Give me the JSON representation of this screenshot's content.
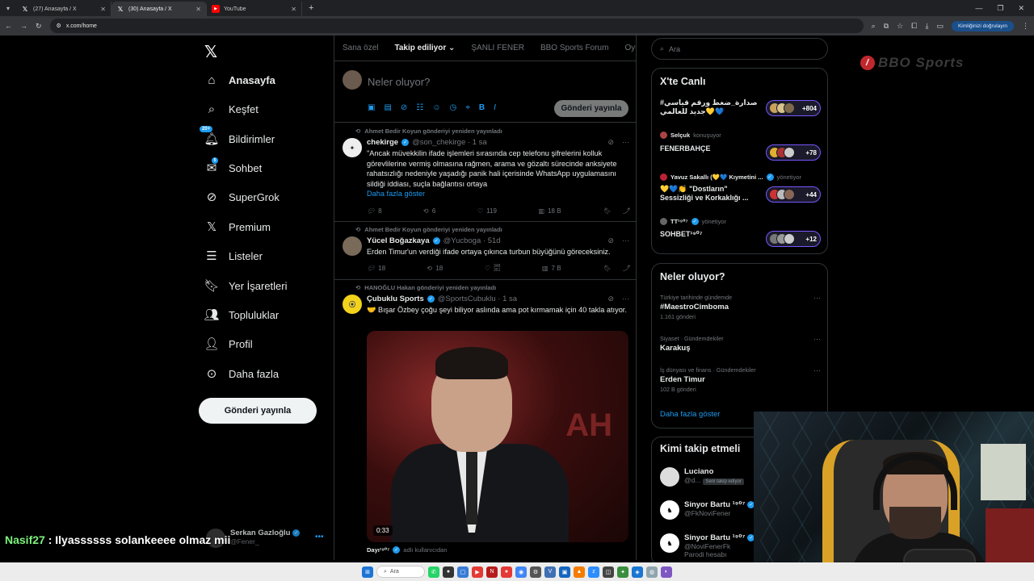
{
  "browser": {
    "tabs": [
      {
        "title": "(27) Anasayfa / X",
        "icon": "x-icon"
      },
      {
        "title": "(30) Anasayfa / X",
        "icon": "x-icon"
      },
      {
        "title": "YouTube",
        "icon": "youtube-icon"
      }
    ],
    "url": "x.com/home",
    "verify_label": "Kimliğinizi doğrulayın"
  },
  "nav": {
    "items": [
      {
        "label": "Anasayfa",
        "icon": "home-icon"
      },
      {
        "label": "Keşfet",
        "icon": "search-icon"
      },
      {
        "label": "Bildirimler",
        "icon": "bell-icon",
        "badge": "20+"
      },
      {
        "label": "Sohbet",
        "icon": "mail-icon",
        "badge": "5"
      },
      {
        "label": "SuperGrok",
        "icon": "grok-icon"
      },
      {
        "label": "Premium",
        "icon": "x-icon"
      },
      {
        "label": "Listeler",
        "icon": "list-icon"
      },
      {
        "label": "Yer İşaretleri",
        "icon": "bookmark-icon"
      },
      {
        "label": "Topluluklar",
        "icon": "communities-icon"
      },
      {
        "label": "Profil",
        "icon": "person-icon"
      },
      {
        "label": "Daha fazla",
        "icon": "more-circle-icon"
      }
    ],
    "post_button": "Gönderi yayınla"
  },
  "timeline": {
    "tabs": [
      "Sana özel",
      "Takip ediliyor",
      "ŞANLI FENER",
      "BBO Sports Forum",
      "Oyuncu"
    ],
    "composer_placeholder": "Neler oluyor?",
    "composer_post": "Gönderi yayınla",
    "tweets": [
      {
        "repost": "Ahmet Bedir Koyun gönderiyi yeniden yayınladı",
        "name": "chekirge",
        "handle": "@son_chekirge · 1 sa",
        "text": "\"Ancak müvekkilin ifade işlemleri sırasında cep telefonu şifrelerini kolluk görevlilerine vermiş olmasına rağmen, arama ve gözaltı sürecinde anksiyete rahatsızlığı nedeniyle yaşadığı panik hali içerisinde WhatsApp uygulamasını sildiği iddiası, suçla bağlantısı ortaya",
        "show_more": "Daha fazla göster",
        "replies": "8",
        "reposts": "6",
        "likes": "119",
        "views": "18 B"
      },
      {
        "repost": "Ahmet Bedir Koyun gönderiyi yeniden yayınladı",
        "name": "Yücel Boğazkaya",
        "handle": "@Yucboga · 51d",
        "text": "Erden Timur'un verdiği ifade ortaya çıkınca turbun büyüğünü göreceksiniz.",
        "replies": "18",
        "reposts": "18",
        "likes": "348\n351",
        "views": "7 B"
      },
      {
        "repost": "HANOĞLU Hakan gönderiyi yeniden yayınladı",
        "name": "Çubuklu Sports",
        "handle": "@SportsCubuklu · 1 sa",
        "text": "🤝 Bışar Özbey çoğu şeyi biliyor aslında ama pot kırmamak için 40 takla atıyor.",
        "video_duration": "0:33",
        "bottom_user": "Dayı¹⁹⁰⁷",
        "bottom_sub": "adlı kullanıcıdan"
      }
    ]
  },
  "right": {
    "search_placeholder": "Ara",
    "live": {
      "title": "X'te Canlı",
      "items": [
        {
          "host": "",
          "host_sub": "",
          "title": "صدارة_ضغط ورقم قياسي#\n💙💛جديد للعالمي",
          "count": "+804"
        },
        {
          "host": "Selçuk",
          "host_sub": "konuşuyor",
          "title": "FENERBAHÇE",
          "count": "+78"
        },
        {
          "host": "Yavuz Sakallı (💛💙 Kıymetini ...",
          "host_sub": "yönetiyor",
          "title": "💛💙👏 \"Dostların\"\nSessizliği ve Korkaklığı ...",
          "count": "+44"
        },
        {
          "host": "TT¹⁹⁰⁷",
          "host_sub": "yönetiyor",
          "title": "SOHBET¹⁹⁰⁷",
          "count": "+12"
        }
      ]
    },
    "trends": {
      "title": "Neler oluyor?",
      "items": [
        {
          "context": "Türkiye tarihinde gündemde",
          "name": "#MaestroCimboma",
          "count": "1.161 gönderi"
        },
        {
          "context": "Siyaset · Gündemdekiler",
          "name": "Karakuş",
          "count": ""
        },
        {
          "context": "İş dünyası ve finans · Gündemdekiler",
          "name": "Erden Timur",
          "count": "102 B gönderi"
        }
      ],
      "show_more": "Daha fazla göster"
    },
    "follow": {
      "title": "Kimi takip etmeli",
      "items": [
        {
          "name": "Luciano",
          "handle": "@d...",
          "follows_you": "Seni takip ediyor"
        },
        {
          "name": "Sinyor Bartu ¹⁹⁰⁷",
          "handle": "@FkNoviFener",
          "follows_you": ""
        },
        {
          "name": "Sinyor Bartu ¹⁹⁰⁷",
          "handle": "@NoviFenerFk",
          "follows_you": ""
        }
      ],
      "parody_label": "Parodi hesabı"
    }
  },
  "stream": {
    "logo_text": "BBO Sports",
    "chat_user": "Nasif27",
    "chat_message": " : Ilyassssss solankeeee olmaz mii",
    "ghost_name": "Serkan Gazloğlu",
    "ghost_handle": "@Fener_"
  },
  "taskbar": {
    "search_label": "Ara"
  }
}
